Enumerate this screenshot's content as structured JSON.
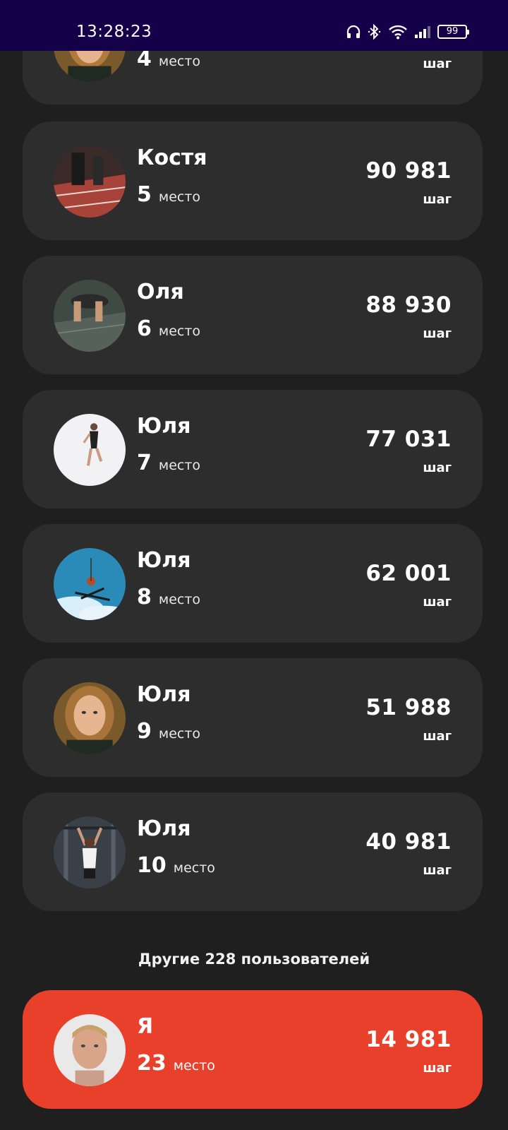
{
  "status_bar": {
    "time": "13:28:23",
    "battery": "99",
    "icons": [
      "headphones-icon",
      "bluetooth-icon",
      "wifi-icon",
      "signal-icon",
      "battery-icon"
    ]
  },
  "leaderboard": {
    "rank_word": "место",
    "unit": "шаг",
    "items": [
      {
        "name": "",
        "rank": "4",
        "steps": "",
        "avatar": "avatar-woman-portrait"
      },
      {
        "name": "Костя",
        "rank": "5",
        "steps": "90 981",
        "avatar": "avatar-runner-track"
      },
      {
        "name": "Оля",
        "rank": "6",
        "steps": "88 930",
        "avatar": "avatar-gym-jump"
      },
      {
        "name": "Юля",
        "rank": "7",
        "steps": "77 031",
        "avatar": "avatar-jumping-woman"
      },
      {
        "name": "Юля",
        "rank": "8",
        "steps": "62 001",
        "avatar": "avatar-skier-sky"
      },
      {
        "name": "Юля",
        "rank": "9",
        "steps": "51 988",
        "avatar": "avatar-woman-portrait"
      },
      {
        "name": "Юля",
        "rank": "10",
        "steps": "40 981",
        "avatar": "avatar-gym-pullup"
      }
    ],
    "others_text": "Другие 228 пользователей",
    "me": {
      "name": "Я",
      "rank": "23",
      "steps": "14 981",
      "avatar": "avatar-man-portrait"
    }
  },
  "colors": {
    "background": "#1f1f1f",
    "card": "#2d2d2d",
    "highlight": "#e8402a",
    "status_bar": "#15004a"
  }
}
